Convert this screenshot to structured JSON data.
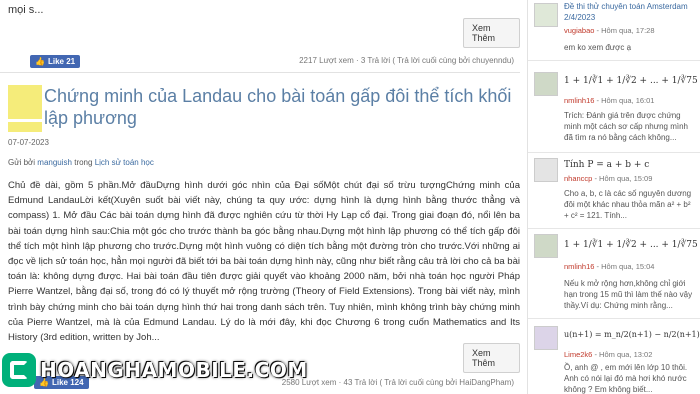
{
  "prev_post": {
    "excerpt": "mọi s...",
    "read_more": "Xem Thêm",
    "like_label": "Like 21",
    "stats": "2217 Lượt xem · 3 Trả lời ( Trả lời cuối cùng bởi chuyenndu)"
  },
  "post": {
    "title": "Chứng minh của Landau cho bài toán gấp đôi thể tích khối lập phương",
    "date": "07-07-2023",
    "by_prefix": "Gửi bởi",
    "author": "manguish",
    "in_label": "trong",
    "category": "Lịch sử toán học",
    "body": "Chủ đề dài, gồm 5 phần.Mở đầuDựng hình dưới góc nhìn của Đại sốMột chút đại số trừu tượngChứng minh của Edmund LandauLời kết(Xuyên suốt bài viết này, chúng ta quy ước: dựng hình là dựng hình bằng thước thẳng và compass) 1. Mở đầu   Các bài toán dựng hình đã được nghiên cứu từ thời Hy Lạp cổ đại. Trong giai đoạn đó, nổi lên ba bài toán dựng hình sau:Chia một góc cho trước thành ba góc bằng nhau.Dựng một hình lập phương có thể tích gấp đôi thể tích một hình lập phương cho trước.Dựng một hình vuông có diện tích bằng một đường tròn cho trước.Với những ai đọc về lịch sử toán học, hẳn mọi người đã biết tới ba bài toán dựng hình này, cũng như biết rằng câu trả lời cho cả ba bài toán là: không dựng được. Hai bài toán đầu tiên được giải quyết vào khoảng 2000 năm, bởi nhà toán học người Pháp Pierre Wantzel, bằng đại số, trong đó có lý thuyết mở rộng trường (Theory of Field Extensions).   Trong bài viết này, mình trình bày chứng minh cho bài toán dựng hình thứ hai trong danh sách trên. Tuy nhiên, mình không trình bày chứng minh của Pierre Wantzel, mà là của Edmund Landau. Lý do là mới đây, khi đọc Chương 6 trong cuốn Mathematics and Its History (3rd edition, written by Joh...",
    "read_more": "Xem Thêm",
    "like_label": "Like 124",
    "stats": "2580 Lượt xem · 43 Trả lời ( Trả lời cuối cùng bởi HaiDangPham)"
  },
  "watermark": "HOANGHAMOBILE.COM",
  "sidebar": [
    {
      "title": "Đề thi thử chuyên toán Amsterdam 2/4/2023",
      "user": "vugiabao",
      "time": "- Hôm qua, 17:28",
      "excerpt": "em ko xem được ạ"
    },
    {
      "formula": "1 + 1/∛1 + 1/∛2 + ... + 1/∛75 > 7",
      "user": "nmlinh16",
      "time": "- Hôm qua, 16:01",
      "excerpt": "Trích: Đánh giá trên được chứng minh một cách sơ cấp nhưng mình đã tìm ra nó bằng cách không..."
    },
    {
      "formula": "Tính P = a + b + c",
      "user": "nhanccp",
      "time": "- Hôm qua, 15:09",
      "excerpt": "Cho a, b, c là các số nguyên dương đôi một khác nhau thỏa mãn a² + b² + c² = 121. Tính..."
    },
    {
      "formula": "1 + 1/∛1 + 1/∛2 + ... + 1/∛75 > 7",
      "user": "nmlinh16",
      "time": "- Hôm qua, 15:04",
      "excerpt": "Nếu k mở rộng hơn,không chỉ giới hạn trong 15 mũ thì làm thế nào vậy thầy.Ví dụ: Chứng minh rằng..."
    },
    {
      "formula": "u(n+1) = m_n/2(n+1) − n/2(n+1)[(n²",
      "user": "Lime2k6",
      "time": "- Hôm qua, 13:02",
      "excerpt": "Ồ, anh @  , em mới lên lớp 10 thôi. Anh có nói lại đó mà hơi khó nước không ? Em không biết..."
    }
  ]
}
